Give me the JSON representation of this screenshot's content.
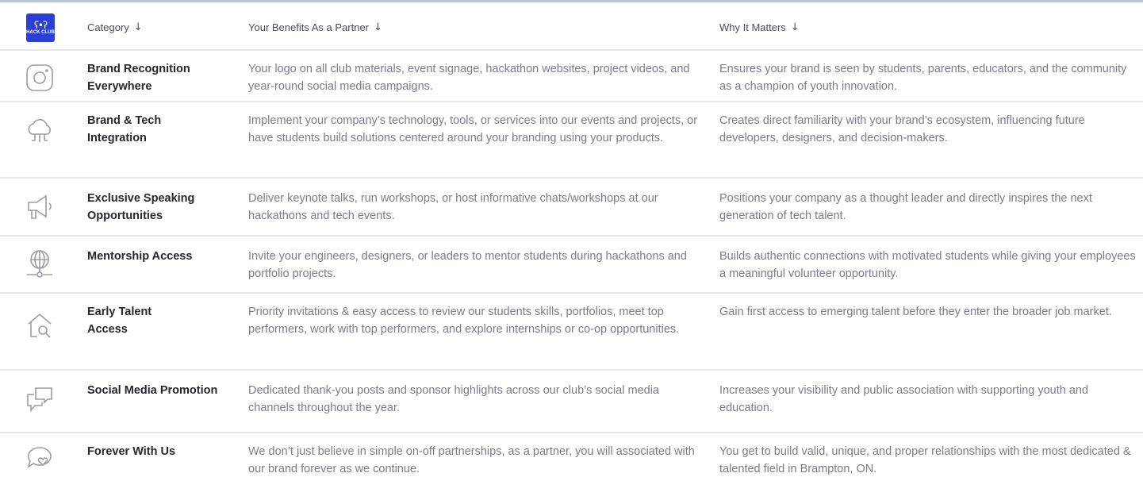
{
  "header": {
    "logo_text": "HACK CLUB",
    "columns": [
      {
        "label": "Category",
        "arrow": "↓"
      },
      {
        "label": "Your Benefits As a Partner",
        "arrow": "↓"
      },
      {
        "label": "Why It Matters",
        "arrow": "↓"
      }
    ]
  },
  "rows": [
    {
      "icon": "instagram-icon",
      "category_line1": "Brand Recognition",
      "category_line2": "Everywhere",
      "benefit": "Your logo on all club materials, event signage, hackathon websites, project videos, and year-round social media campaigns.",
      "why": "Ensures your brand is seen by students, parents, educators, and the community as a champion of youth innovation."
    },
    {
      "icon": "cloud-network-icon",
      "category_line1": "Brand & Tech",
      "category_line2": "Integration",
      "benefit": "Implement your company’s technology, tools, or services into our events and projects, or have students build solutions centered around your branding using your products.",
      "why": "Creates direct familiarity with your brand’s ecosystem, influencing future developers, designers, and decision-makers."
    },
    {
      "icon": "megaphone-icon",
      "category_line1": "Exclusive Speaking",
      "category_line2": "Opportunities",
      "benefit": "Deliver keynote talks, run workshops, or host informative chats/workshops at our hackathons and tech events.",
      "why": "Positions your company as a thought leader and directly inspires the next generation of tech talent."
    },
    {
      "icon": "globe-network-icon",
      "category_line1": "Mentorship Access",
      "category_line2": "",
      "benefit": "Invite your engineers, designers, or leaders to mentor students during hackathons and portfolio projects.",
      "why": "Builds authentic connections with motivated students while giving your employees a meaningful volunteer opportunity."
    },
    {
      "icon": "house-search-icon",
      "category_line1": "Early Talent",
      "category_line2": "Access",
      "benefit": "Priority invitations & easy access to review our students skills, portfolios, meet top performers, work with top performers, and explore internships or co-op opportunities.",
      "why": "Gain first access to emerging talent before they enter the broader job market."
    },
    {
      "icon": "chat-bubbles-icon",
      "category_line1": "Social Media Promotion",
      "category_line2": "",
      "benefit": "Dedicated thank-you posts and sponsor highlights across our club’s social media channels throughout the year.",
      "why": "Increases your visibility and public association with supporting youth and education."
    },
    {
      "icon": "chat-heart-icon",
      "category_line1": "Forever With Us",
      "category_line2": "",
      "benefit": "We don’t just believe in simple on-off partnerships, as a partner, you will associated with our brand forever as we continue.",
      "why": "You get to build valid, unique, and proper relationships with the most dedicated & talented field in Brampton, ON."
    }
  ]
}
